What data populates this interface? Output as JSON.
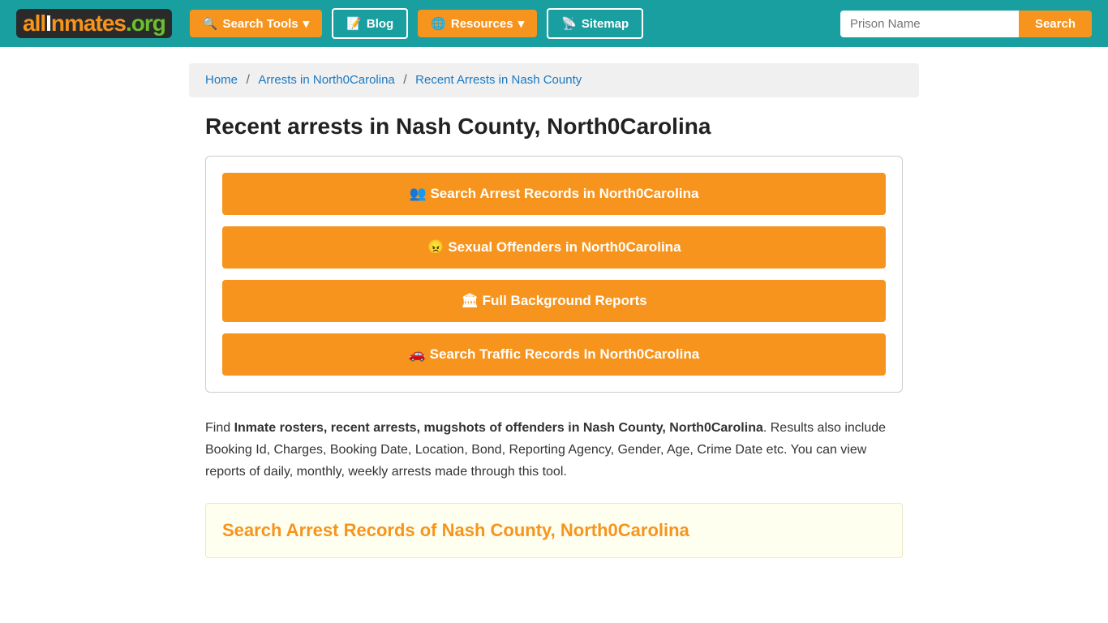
{
  "header": {
    "logo": "allInmates.org",
    "nav": [
      {
        "id": "search-tools",
        "label": "Search Tools",
        "icon": "search-icon",
        "dropdown": true
      },
      {
        "id": "blog",
        "label": "Blog",
        "icon": "blog-icon",
        "dropdown": false
      },
      {
        "id": "resources",
        "label": "Resources",
        "icon": "resources-icon",
        "dropdown": true
      },
      {
        "id": "sitemap",
        "label": "Sitemap",
        "icon": "sitemap-icon",
        "dropdown": false
      }
    ],
    "prison_input_placeholder": "Prison Name",
    "search_button_label": "Search"
  },
  "breadcrumb": {
    "items": [
      {
        "label": "Home",
        "href": "#"
      },
      {
        "label": "Arrests in North0Carolina",
        "href": "#"
      },
      {
        "label": "Recent Arrests in Nash County",
        "href": "#"
      }
    ]
  },
  "main": {
    "page_title": "Recent arrests in Nash County, North0Carolina",
    "action_buttons": [
      {
        "id": "arrest-records",
        "label": "Search Arrest Records in North0Carolina",
        "icon": "users-icon"
      },
      {
        "id": "sex-offenders",
        "label": "Sexual Offenders in North0Carolina",
        "icon": "offender-icon"
      },
      {
        "id": "background-reports",
        "label": "Full Background Reports",
        "icon": "bg-icon"
      },
      {
        "id": "traffic-records",
        "label": "Search Traffic Records In North0Carolina",
        "icon": "car-icon"
      }
    ],
    "description_part1": "Find ",
    "description_bold": "Inmate rosters, recent arrests, mugshots of offenders in Nash County, North0Carolina",
    "description_part2": ". Results also include Booking Id, Charges, Booking Date, Location, Bond, Reporting Agency, Gender, Age, Crime Date etc. You can view reports of daily, monthly, weekly arrests made through this tool.",
    "search_section_title": "Search Arrest Records of Nash County, North0Carolina"
  },
  "colors": {
    "teal": "#1a9fa0",
    "orange": "#f7941d",
    "link_blue": "#1a78c2"
  }
}
